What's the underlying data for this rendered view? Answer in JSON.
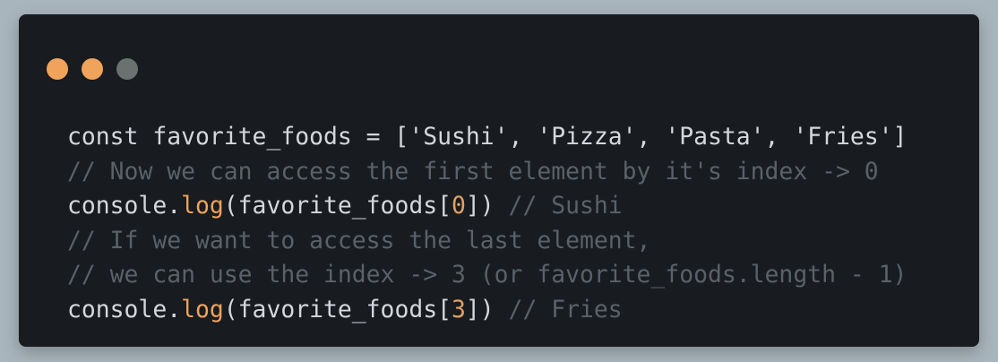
{
  "colors": {
    "background": "#a9b5bd",
    "window": "#181b1f",
    "text": "#d4d7dc",
    "comment": "#5b6168",
    "function": "#f0a35a",
    "number": "#e0a165",
    "dot_close": "#f0a35a",
    "dot_minimize": "#f0a35a",
    "dot_maximize": "#6b7071"
  },
  "window_controls": [
    {
      "name": "close-dot",
      "color": "#f0a35a"
    },
    {
      "name": "minimize-dot",
      "color": "#f0a35a"
    },
    {
      "name": "maximize-dot",
      "color": "#6b7071"
    }
  ],
  "code": {
    "line1": "const favorite_foods = ['Sushi', 'Pizza', 'Pasta', 'Fries']",
    "line2": "// Now we can access the first element by it's index -> 0",
    "line3": {
      "obj": "console.",
      "fn": "log",
      "args_open": "(favorite_foods[",
      "index": "0",
      "args_close": "])",
      "comment": " // Sushi"
    },
    "line4": "// If we want to access the last element,",
    "line5": "// we can use the index -> 3 (or favorite_foods.length - 1)",
    "line6": {
      "obj": "console.",
      "fn": "log",
      "args_open": "(favorite_foods[",
      "index": "3",
      "args_close": "])",
      "comment": " // Fries"
    }
  }
}
